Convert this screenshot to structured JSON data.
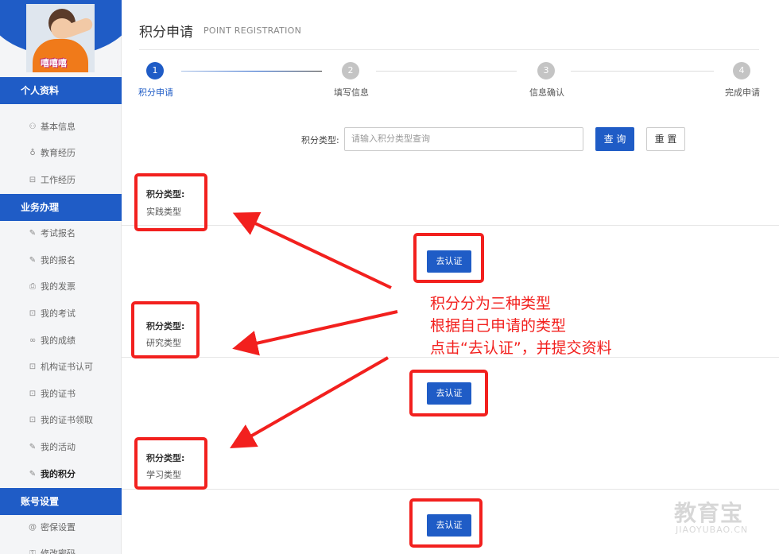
{
  "sidebar": {
    "avatar_caption": "嘻嘻嘻",
    "sections": [
      {
        "title": "个人资料",
        "items": [
          {
            "icon": "user-icon",
            "glyph": "⚇",
            "label": "基本信息"
          },
          {
            "icon": "education-icon",
            "glyph": "♁",
            "label": "教育经历"
          },
          {
            "icon": "briefcase-icon",
            "glyph": "⊟",
            "label": "工作经历"
          }
        ]
      },
      {
        "title": "业务办理",
        "items": [
          {
            "icon": "pencil-icon",
            "glyph": "✎",
            "label": "考试报名"
          },
          {
            "icon": "edit-icon",
            "glyph": "✎",
            "label": "我的报名"
          },
          {
            "icon": "printer-icon",
            "glyph": "⎙",
            "label": "我的发票"
          },
          {
            "icon": "book-icon",
            "glyph": "⊡",
            "label": "我的考试"
          },
          {
            "icon": "glasses-icon",
            "glyph": "∞",
            "label": "我的成绩"
          },
          {
            "icon": "book-icon",
            "glyph": "⊡",
            "label": "机构证书认可"
          },
          {
            "icon": "book-icon",
            "glyph": "⊡",
            "label": "我的证书"
          },
          {
            "icon": "book-icon",
            "glyph": "⊡",
            "label": "我的证书领取"
          },
          {
            "icon": "edit-icon",
            "glyph": "✎",
            "label": "我的活动"
          },
          {
            "icon": "edit-icon",
            "glyph": "✎",
            "label": "我的积分",
            "active": true
          }
        ]
      },
      {
        "title": "账号设置",
        "items": [
          {
            "icon": "at-icon",
            "glyph": "@",
            "label": "密保设置"
          },
          {
            "icon": "lock-icon",
            "glyph": "⚿",
            "label": "修改密码"
          }
        ]
      }
    ]
  },
  "header": {
    "title": "积分申请",
    "subtitle": "POINT REGISTRATION"
  },
  "steps": [
    {
      "num": "1",
      "label": "积分申请",
      "active": true
    },
    {
      "num": "2",
      "label": "填写信息",
      "active": false
    },
    {
      "num": "3",
      "label": "信息确认",
      "active": false
    },
    {
      "num": "4",
      "label": "完成申请",
      "active": false
    }
  ],
  "filter": {
    "label": "积分类型:",
    "placeholder": "请输入积分类型查询",
    "query_label": "查 询",
    "reset_label": "重 置"
  },
  "cards": [
    {
      "label": "积分类型:",
      "value": "实践类型",
      "button": "去认证"
    },
    {
      "label": "积分类型:",
      "value": "研究类型",
      "button": "去认证"
    },
    {
      "label": "积分类型:",
      "value": "学习类型",
      "button": "去认证"
    }
  ],
  "annotation": {
    "lines": [
      "积分分为三种类型",
      "根据自己申请的类型",
      "点击“去认证”，并提交资料"
    ]
  },
  "watermark": {
    "main": "教育宝",
    "sub": "JIAOYUBAO.CN"
  },
  "colors": {
    "primary": "#1f5cc6",
    "annotation_red": "#f2201e"
  }
}
